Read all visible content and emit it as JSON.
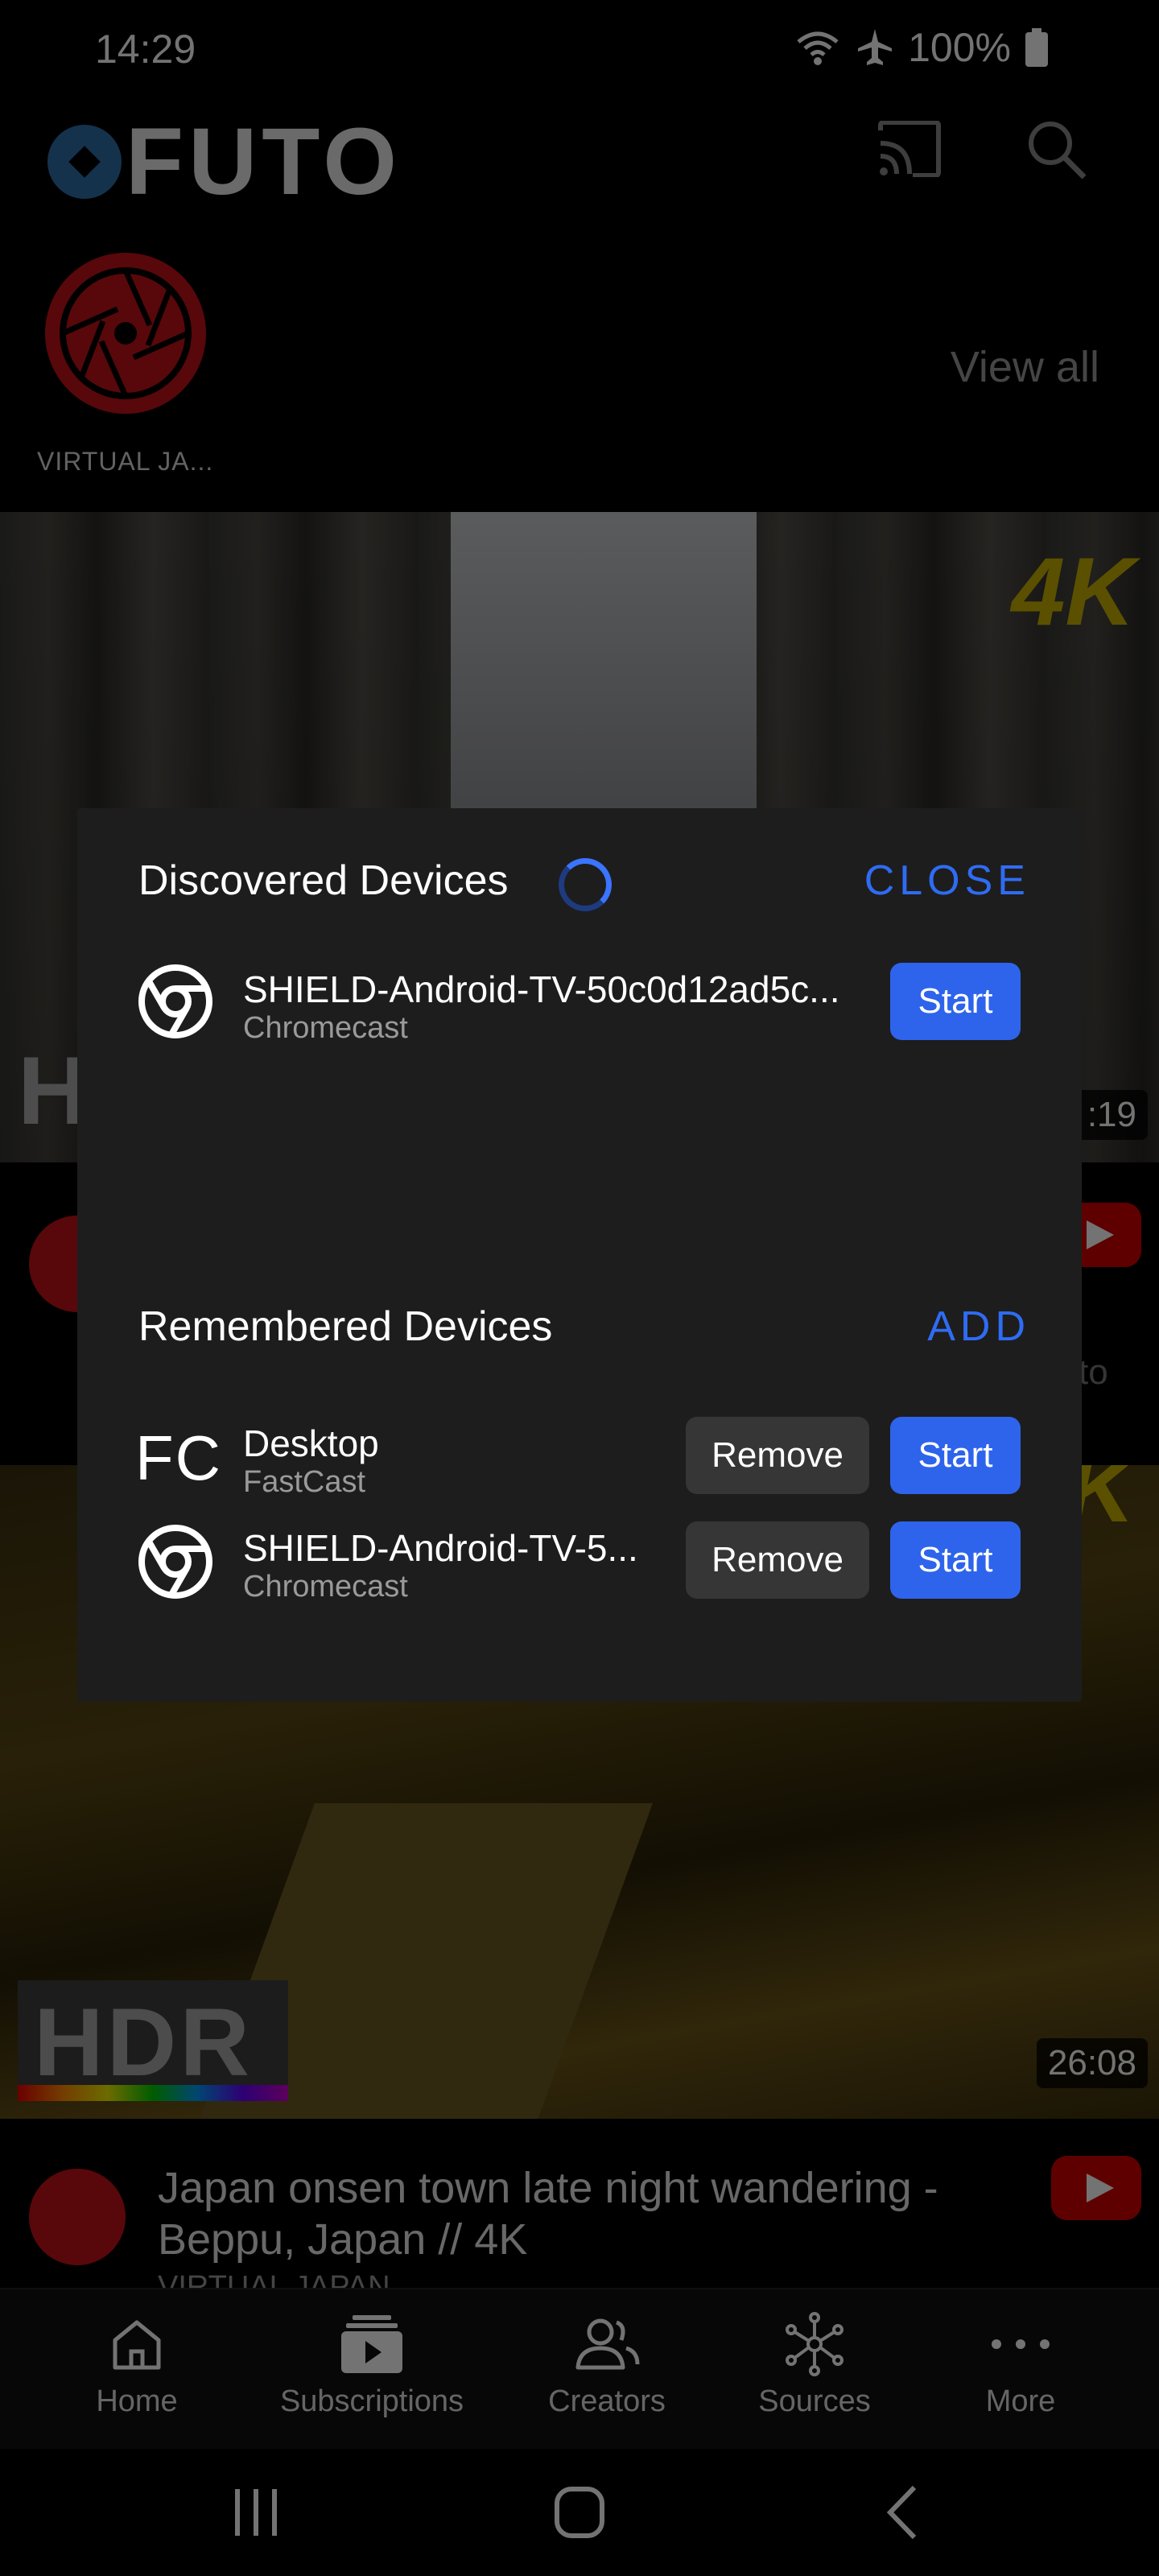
{
  "status_bar": {
    "time": "14:29",
    "battery": "100%"
  },
  "header": {
    "logo_text": "FUTO",
    "icons": [
      "cast-icon",
      "search-icon"
    ]
  },
  "creators": {
    "first_name": "VIRTUAL JA...",
    "view_all": "View all"
  },
  "videos": [
    {
      "duration": ":19"
    },
    {
      "partial_text": "to"
    },
    {
      "duration": "26:08",
      "badge": "HDR",
      "title": "Japan onsen town late night wandering - Beppu, Japan // 4K",
      "channel": "VIRTUAL JAPAN"
    }
  ],
  "dialog": {
    "discovered_title": "Discovered Devices",
    "close_label": "CLOSE",
    "discovered": [
      {
        "name": "SHIELD-Android-TV-50c0d12ad5c...",
        "type": "Chromecast",
        "start": "Start"
      }
    ],
    "remembered_title": "Remembered Devices",
    "add_label": "ADD",
    "remembered": [
      {
        "icon_text": "FC",
        "name": "Desktop",
        "type": "FastCast",
        "remove": "Remove",
        "start": "Start"
      },
      {
        "name": "SHIELD-Android-TV-5...",
        "type": "Chromecast",
        "remove": "Remove",
        "start": "Start"
      }
    ]
  },
  "bottom_nav": [
    "Home",
    "Subscriptions",
    "Creators",
    "Sources",
    "More"
  ],
  "colors": {
    "accent": "#2f6cf4",
    "button_start": "#2e64ec",
    "dialog_bg": "#1d1d1d",
    "youtube_red": "#d20000"
  }
}
